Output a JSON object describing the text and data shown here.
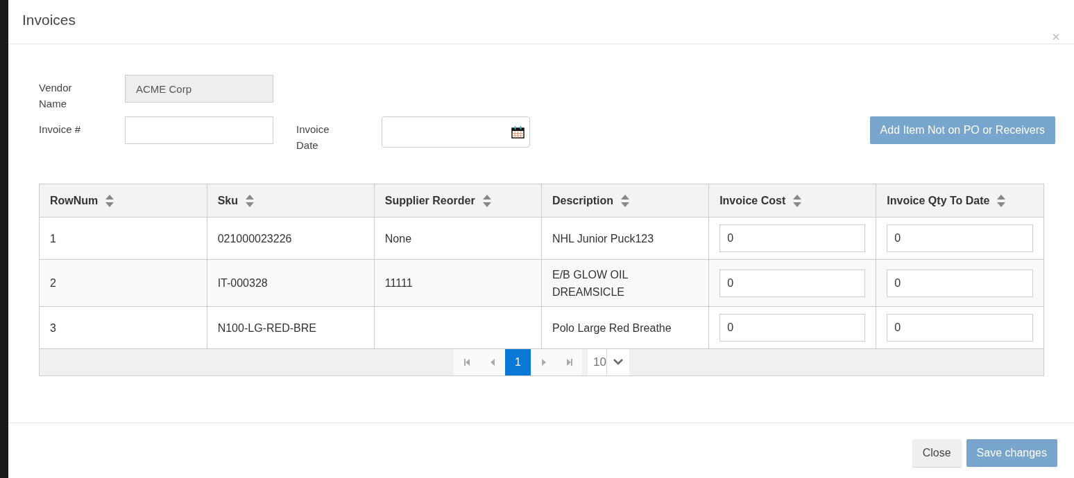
{
  "window": {
    "title": "Invoices",
    "close": "×"
  },
  "form": {
    "vendor_name": {
      "label": "Vendor Name",
      "value": "ACME Corp",
      "disabled": true
    },
    "invoice_number": {
      "label": "Invoice #"
    },
    "invoice_date": {
      "label": "Invoice Date"
    },
    "add_button": "Add Item Not on PO or Receivers"
  },
  "table": {
    "columns": [
      "RowNum",
      "Sku",
      "Supplier Reorder",
      "Description",
      "Invoice Cost",
      "Invoice Qty To Date"
    ],
    "rows": [
      {
        "row_num": "1",
        "sku": "021000023226",
        "supplier_reorder": "None",
        "description": "NHL Junior Puck123",
        "invoice_cost": "0",
        "invoice_qty_to_date": "0"
      },
      {
        "row_num": "2",
        "sku": "IT-000328",
        "supplier_reorder": "11111",
        "description": "E/B GLOW OIL DREAMSICLE",
        "invoice_cost": "0",
        "invoice_qty_to_date": "0"
      },
      {
        "row_num": "3",
        "sku": "N100-LG-RED-BRE",
        "description": "Polo Large Red Breathe",
        "invoice_cost": "0",
        "invoice_qty_to_date": "0"
      }
    ]
  },
  "pager": {
    "pages": [
      {
        "label": "1",
        "selected": true
      }
    ],
    "page_size": "10"
  },
  "footer": {
    "buttons": [
      {
        "label": "Close",
        "kind": "default"
      },
      {
        "label": "Save changes",
        "kind": "primary"
      }
    ]
  }
}
